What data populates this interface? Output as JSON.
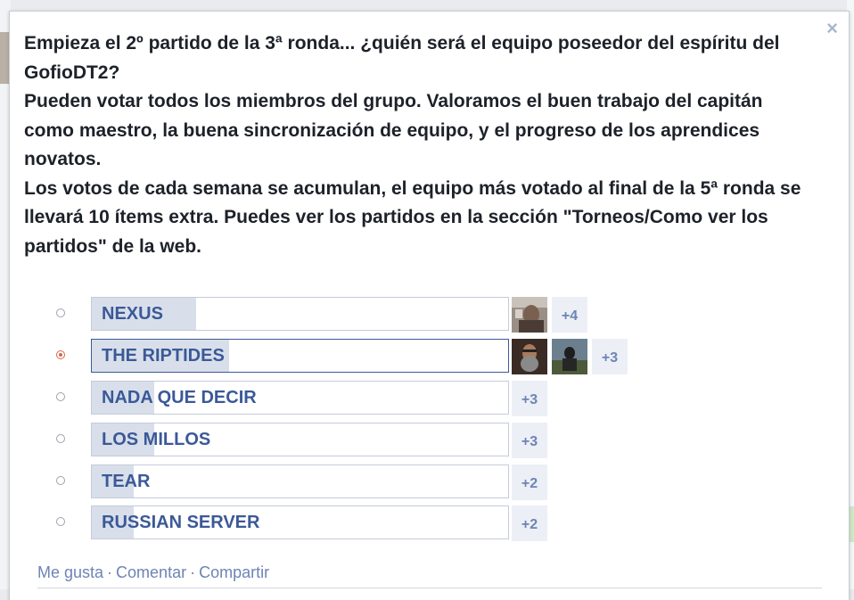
{
  "close_label": "×",
  "question": "Empieza el 2º partido de la 3ª ronda... ¿quién será el equipo poseedor del espíritu del GofioDT2?\nPueden votar todos los miembros del grupo. Valoramos el buen trabajo del capitán como maestro, la buena sincronización de equipo, y el progreso de los aprendices novatos.\nLos votos de cada semana se acumulan, el equipo más votado al final de la 5ª ronda se llevará 10 ítems extra. Puedes ver los partidos en la sección \"Torneos/Como ver los partidos\" de la web.",
  "options": [
    {
      "label": "NEXUS",
      "selected": false,
      "fill": 0.25,
      "avatar_count": 1,
      "more": "+4"
    },
    {
      "label": "THE RIPTIDES",
      "selected": true,
      "fill": 0.33,
      "avatar_count": 2,
      "more": "+3"
    },
    {
      "label": "NADA QUE DECIR",
      "selected": false,
      "fill": 0.15,
      "avatar_count": 0,
      "more": "+3"
    },
    {
      "label": "LOS MILLOS",
      "selected": false,
      "fill": 0.15,
      "avatar_count": 0,
      "more": "+3"
    },
    {
      "label": "TEAR",
      "selected": false,
      "fill": 0.1,
      "avatar_count": 0,
      "more": "+2"
    },
    {
      "label": "RUSSIAN SERVER",
      "selected": false,
      "fill": 0.1,
      "avatar_count": 0,
      "more": "+2"
    }
  ],
  "actions": {
    "like": "Me gusta",
    "comment": "Comentar",
    "share": "Compartir",
    "separator": "·"
  },
  "colors": {
    "link": "#3b5998",
    "fill": "#d8dfea",
    "radio_selected": "#d9664c"
  }
}
